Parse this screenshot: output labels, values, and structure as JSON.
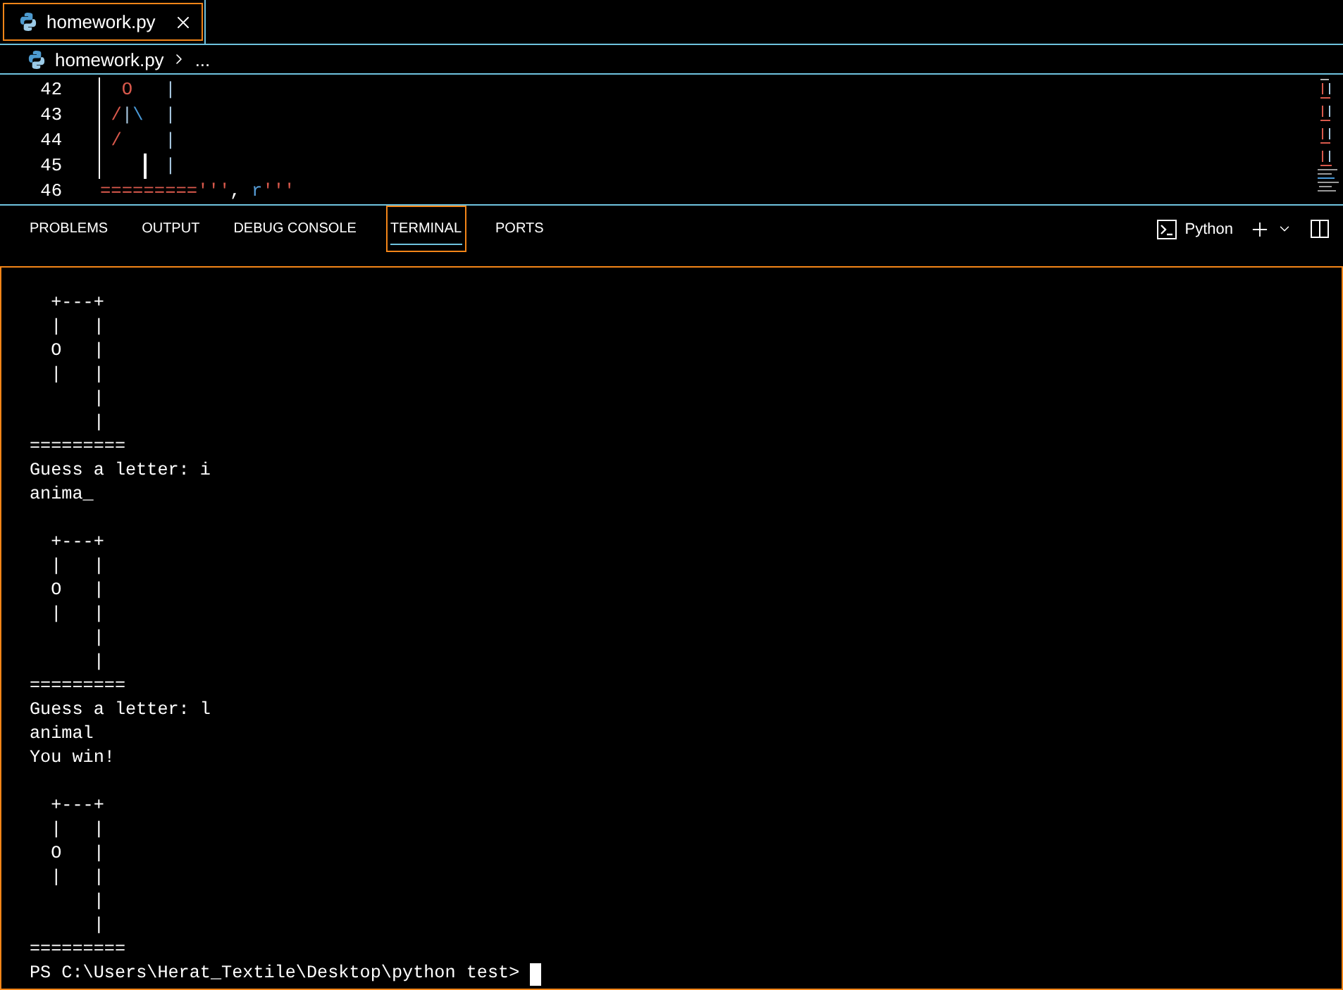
{
  "editor_tabs": [
    {
      "label": "homework.py",
      "selected": true
    }
  ],
  "breadcrumbs": [
    {
      "label": "homework.py",
      "kind": "file"
    },
    {
      "label": "...",
      "kind": "more"
    }
  ],
  "code_lines": [
    {
      "number": "42",
      "indent_guide": true,
      "cursor": false,
      "tokens": [
        {
          "text": "  O",
          "kind": "string"
        },
        {
          "text": "   |",
          "kind": "operator"
        }
      ]
    },
    {
      "number": "43",
      "indent_guide": true,
      "cursor": false,
      "tokens": [
        {
          "text": " /",
          "kind": "string"
        },
        {
          "text": "|",
          "kind": "operator"
        },
        {
          "text": "\\",
          "kind": "escape"
        },
        {
          "text": "  |",
          "kind": "operator"
        }
      ]
    },
    {
      "number": "44",
      "indent_guide": true,
      "cursor": false,
      "tokens": [
        {
          "text": " /",
          "kind": "string"
        },
        {
          "text": "    |",
          "kind": "operator"
        }
      ]
    },
    {
      "number": "45",
      "indent_guide": true,
      "cursor": true,
      "tokens": [
        {
          "text": "      |",
          "kind": "operator"
        }
      ]
    },
    {
      "number": "46",
      "indent_guide": false,
      "cursor": false,
      "tokens": [
        {
          "text": "========='''",
          "kind": "string"
        },
        {
          "text": ",",
          "kind": "plain"
        },
        {
          "text": " r",
          "kind": "keyword"
        },
        {
          "text": "'''",
          "kind": "string"
        }
      ]
    }
  ],
  "panel": {
    "tabs": [
      {
        "label": "PROBLEMS",
        "selected": false
      },
      {
        "label": "OUTPUT",
        "selected": false
      },
      {
        "label": "DEBUG CONSOLE",
        "selected": false
      },
      {
        "label": "TERMINAL",
        "selected": true
      },
      {
        "label": "PORTS",
        "selected": false
      }
    ],
    "profile": "Python"
  },
  "terminal": {
    "blocks": [
      {
        "lines": [
          "  +---+",
          "  |   |",
          "  O   |",
          "  |   |",
          "      |",
          "      |",
          "=========",
          "Guess a letter: i",
          "anima_"
        ]
      },
      {
        "lines": [
          "  +---+",
          "  |   |",
          "  O   |",
          "  |   |",
          "      |",
          "      |",
          "=========",
          "Guess a letter: l",
          "animal",
          "You win!"
        ]
      },
      {
        "lines": [
          "  +---+",
          "  |   |",
          "  O   |",
          "  |   |",
          "      |",
          "      |",
          "========="
        ]
      }
    ],
    "prompt": "PS C:\\Users\\Herat_Textile\\Desktop\\python test>",
    "cursor": true
  }
}
